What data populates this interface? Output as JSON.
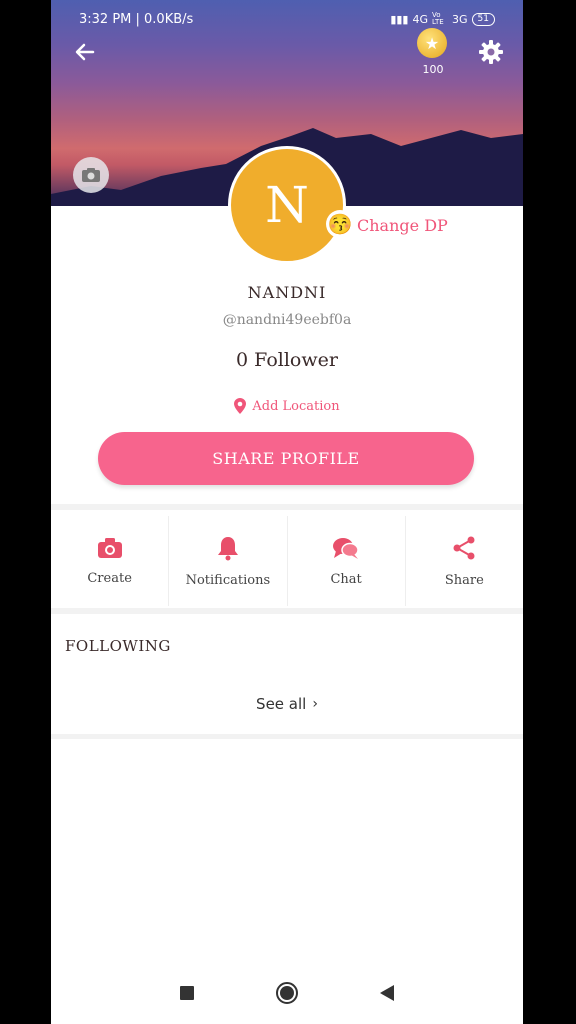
{
  "status_bar": {
    "time": "3:32 PM | 0.0KB/s",
    "network": "4G",
    "volte": "Vo LTE",
    "network2": "3G",
    "battery": "51"
  },
  "header": {
    "coin_count": "100",
    "icons": [
      "back-arrow-icon",
      "coin-icon",
      "gear-icon",
      "camera-icon"
    ]
  },
  "profile": {
    "avatar_letter": "N",
    "avatar_color": "#f0ad2c",
    "dp_emoji": "😚",
    "change_dp_label": "Change DP",
    "name": "NANDNI",
    "handle": "@nandni49eebf0a",
    "followers": "0 Follower",
    "add_location_label": "Add Location",
    "share_profile_label": "SHARE PROFILE"
  },
  "actions": [
    {
      "label": "Create",
      "icon": "camera-icon"
    },
    {
      "label": "Notifications",
      "icon": "bell-icon"
    },
    {
      "label": "Chat",
      "icon": "chat-icon"
    },
    {
      "label": "Share",
      "icon": "share-icon"
    }
  ],
  "following": {
    "title": "FOLLOWING",
    "see_all_label": "See all"
  },
  "colors": {
    "accent": "#f7648d",
    "accent_text": "#f0567a",
    "avatar": "#f0ad2c"
  },
  "nav_bar": [
    "square-icon",
    "circle-icon",
    "back-triangle-icon"
  ]
}
